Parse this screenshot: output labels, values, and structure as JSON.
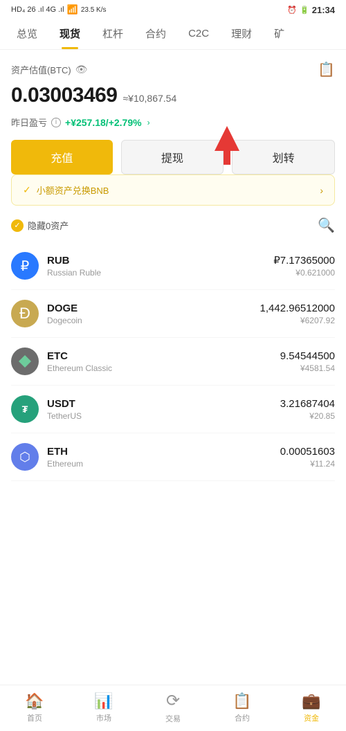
{
  "statusBar": {
    "left": "HD₄  26  ᵢₗₗ  4G  ᵢₗₗ",
    "speed": "23.5 K/s",
    "time": "21:34",
    "battery": "20"
  },
  "navTabs": [
    {
      "label": "总览",
      "active": false
    },
    {
      "label": "现货",
      "active": true
    },
    {
      "label": "杠杆",
      "active": false
    },
    {
      "label": "合约",
      "active": false
    },
    {
      "label": "C2C",
      "active": false
    },
    {
      "label": "理财",
      "active": false
    },
    {
      "label": "矿",
      "active": false
    }
  ],
  "assetSection": {
    "label": "资产估值(BTC)",
    "btcValue": "0.03003469",
    "cnyApprox": "≈¥10,867.54",
    "pnlLabel": "昨日盈亏",
    "pnlValue": "+¥257.18/+2.79%"
  },
  "buttons": {
    "deposit": "充值",
    "withdraw": "提现",
    "transfer": "划转"
  },
  "bnbBanner": {
    "text": "小额资产兑换BNB"
  },
  "listControls": {
    "hideZero": "隐藏0资产"
  },
  "assets": [
    {
      "symbol": "RUB",
      "name": "Russian Ruble",
      "amount": "₽7.17365000",
      "cny": "¥0.621000",
      "iconType": "rub"
    },
    {
      "symbol": "DOGE",
      "name": "Dogecoin",
      "amount": "1,442.96512000",
      "cny": "¥6207.92",
      "iconType": "doge"
    },
    {
      "symbol": "ETC",
      "name": "Ethereum Classic",
      "amount": "9.54544500",
      "cny": "¥4581.54",
      "iconType": "etc"
    },
    {
      "symbol": "USDT",
      "name": "TetherUS",
      "amount": "3.21687404",
      "cny": "¥20.85",
      "iconType": "usdt"
    },
    {
      "symbol": "ETH",
      "name": "Ethereum",
      "amount": "0.00051603",
      "cny": "¥11.24",
      "iconType": "eth"
    }
  ],
  "bottomNav": [
    {
      "label": "首页",
      "active": false,
      "icon": "🏠"
    },
    {
      "label": "市场",
      "active": false,
      "icon": "📊"
    },
    {
      "label": "交易",
      "active": false,
      "icon": "🔄"
    },
    {
      "label": "合约",
      "active": false,
      "icon": "📋"
    },
    {
      "label": "资金",
      "active": true,
      "icon": "💼"
    }
  ]
}
